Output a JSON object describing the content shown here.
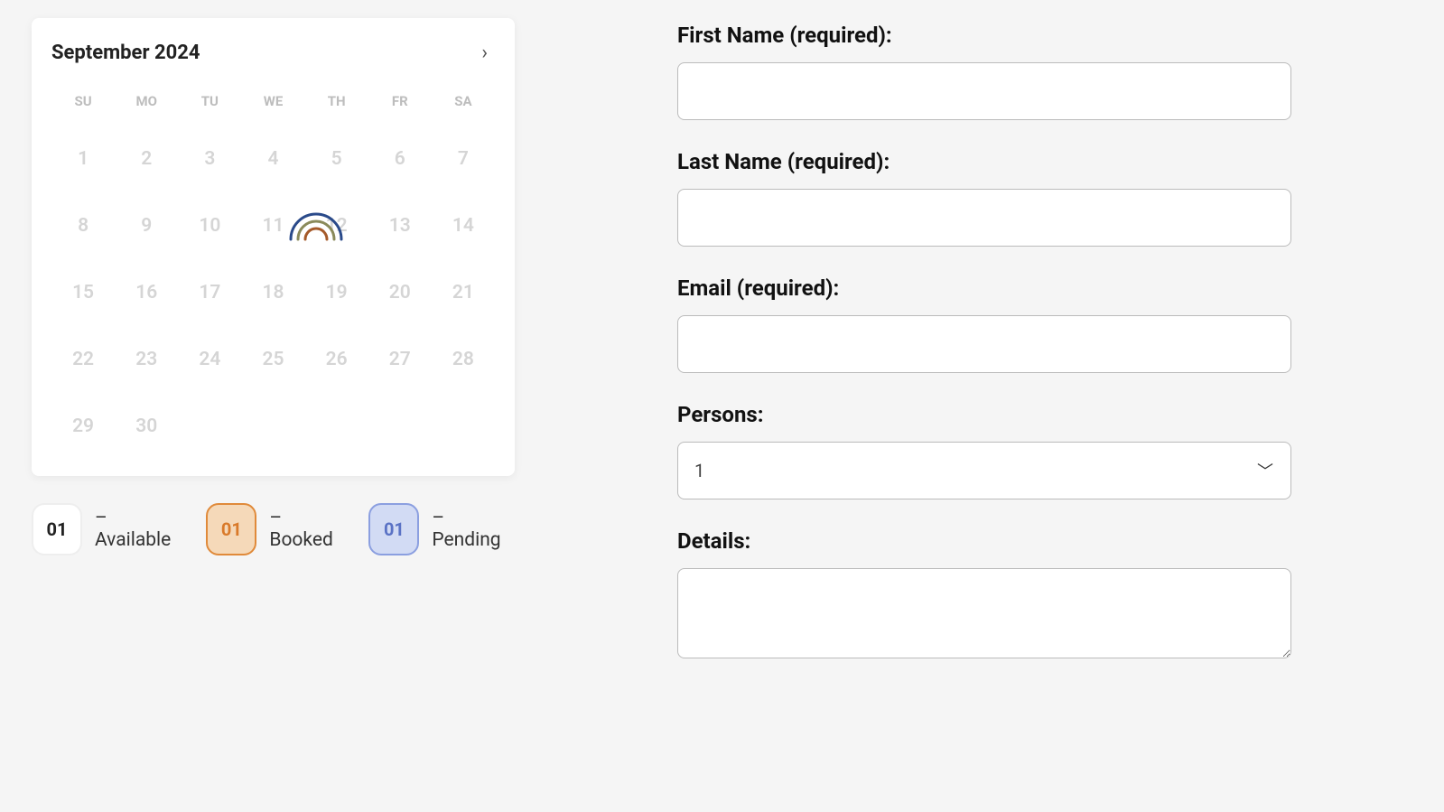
{
  "calendar": {
    "title": "September 2024",
    "dow": [
      "SU",
      "MO",
      "TU",
      "WE",
      "TH",
      "FR",
      "SA"
    ],
    "days": [
      "1",
      "2",
      "3",
      "4",
      "5",
      "6",
      "7",
      "8",
      "9",
      "10",
      "11",
      "12",
      "13",
      "14",
      "15",
      "16",
      "17",
      "18",
      "19",
      "20",
      "21",
      "22",
      "23",
      "24",
      "25",
      "26",
      "27",
      "28",
      "29",
      "30"
    ]
  },
  "legend": {
    "available": {
      "num": "01",
      "label": "– Available"
    },
    "booked": {
      "num": "01",
      "label": "– Booked"
    },
    "pending": {
      "num": "01",
      "label": "– Pending"
    }
  },
  "form": {
    "first_name_label": "First Name (required):",
    "last_name_label": "Last Name (required):",
    "email_label": "Email (required):",
    "persons_label": "Persons:",
    "persons_value": "1",
    "details_label": "Details:"
  }
}
